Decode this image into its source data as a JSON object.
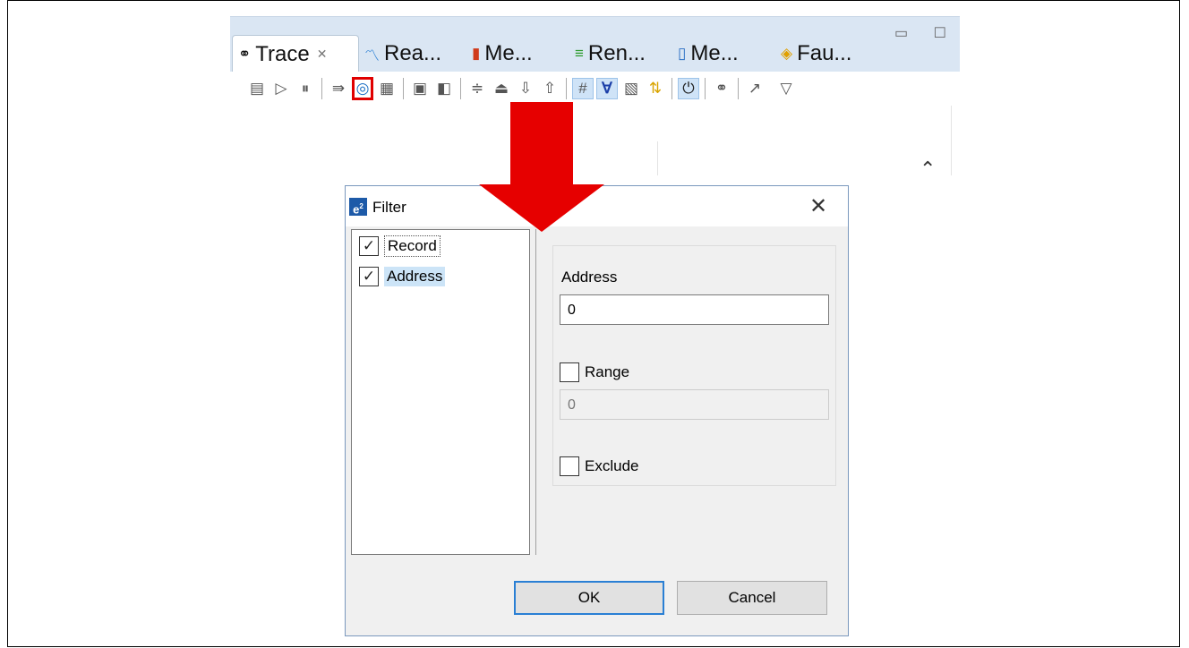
{
  "ide": {
    "tabs": [
      {
        "icon": "⚭",
        "label": "Trace",
        "close": "✕"
      },
      {
        "icon": "〽",
        "label": "Rea..."
      },
      {
        "icon": "▮",
        "label": "Me..."
      },
      {
        "icon": "≡",
        "label": "Ren..."
      },
      {
        "icon": "▯",
        "label": "Me..."
      },
      {
        "icon": "◈",
        "label": "Fau..."
      }
    ],
    "window_buttons": "▭ ☐",
    "toolbar_highlight_icon": "filter-icon",
    "scroll_up": "⌃"
  },
  "colors": {
    "arrow": "#e60000",
    "highlight_box": "#e00000",
    "tab_bar": "#dae6f3",
    "selection": "#cce4f7"
  },
  "dialog": {
    "logo": "e",
    "logo_sup": "2",
    "title": "Filter",
    "close": "✕",
    "tree": [
      {
        "label": "Record",
        "checked": true
      },
      {
        "label": "Address",
        "checked": true
      }
    ],
    "check_mark": "✓",
    "address_label": "Address",
    "address_value": "0",
    "range_label": "Range",
    "range_value": "0",
    "exclude_label": "Exclude",
    "ok_label": "OK",
    "cancel_label": "Cancel"
  }
}
